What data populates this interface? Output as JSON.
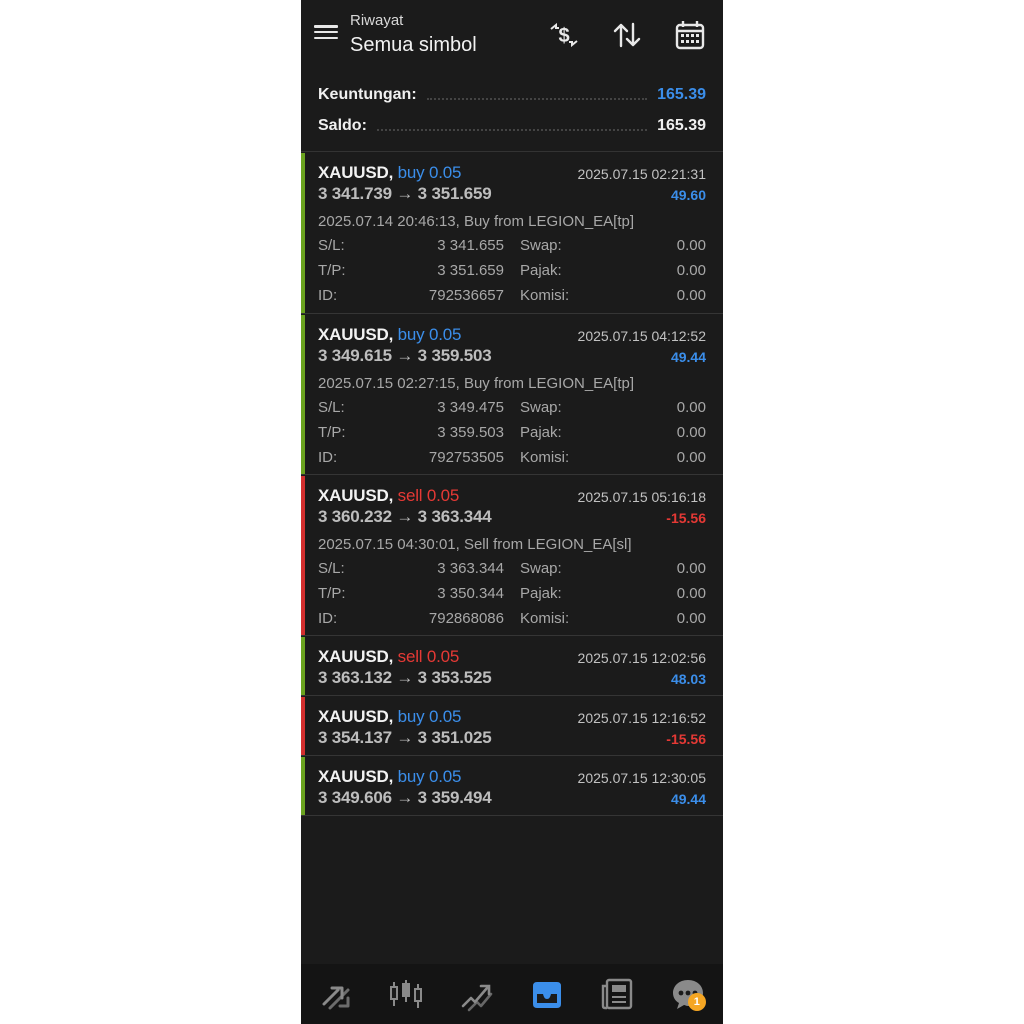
{
  "colors": {
    "blue": "#3b8eea",
    "red": "#e53935",
    "green_bar": "#6aa31f",
    "red_bar": "#d32f2f"
  },
  "header": {
    "subtitle": "Riwayat",
    "title": "Semua simbol",
    "icons": [
      "currency-exchange-icon",
      "sort-arrows-icon",
      "calendar-icon"
    ]
  },
  "summary": {
    "profit_label": "Keuntungan:",
    "profit_value": "165.39",
    "balance_label": "Saldo:",
    "balance_value": "165.39"
  },
  "deals": [
    {
      "symbol": "XAUUSD,",
      "side": "buy 0.05",
      "side_color": "blue",
      "prices": "3 341.739 → 3 351.659",
      "time": "2025.07.15 02:21:31",
      "profit": "49.60",
      "profit_color": "blue",
      "bar": "green",
      "expanded": true,
      "comment": "2025.07.14 20:46:13, Buy from LEGION_EA[tp]",
      "sl_label": "S/L:",
      "sl": "3 341.655",
      "tp_label": "T/P:",
      "tp": "3 351.659",
      "id_label": "ID:",
      "id": "792536657",
      "swap_label": "Swap:",
      "swap": "0.00",
      "tax_label": "Pajak:",
      "tax": "0.00",
      "commission_label": "Komisi:",
      "commission": "0.00"
    },
    {
      "symbol": "XAUUSD,",
      "side": "buy 0.05",
      "side_color": "blue",
      "prices": "3 349.615 → 3 359.503",
      "time": "2025.07.15 04:12:52",
      "profit": "49.44",
      "profit_color": "blue",
      "bar": "green",
      "expanded": true,
      "comment": "2025.07.15 02:27:15, Buy from LEGION_EA[tp]",
      "sl_label": "S/L:",
      "sl": "3 349.475",
      "tp_label": "T/P:",
      "tp": "3 359.503",
      "id_label": "ID:",
      "id": "792753505",
      "swap_label": "Swap:",
      "swap": "0.00",
      "tax_label": "Pajak:",
      "tax": "0.00",
      "commission_label": "Komisi:",
      "commission": "0.00"
    },
    {
      "symbol": "XAUUSD,",
      "side": "sell 0.05",
      "side_color": "red",
      "prices": "3 360.232 → 3 363.344",
      "time": "2025.07.15 05:16:18",
      "profit": "-15.56",
      "profit_color": "red",
      "bar": "red",
      "expanded": true,
      "comment": "2025.07.15 04:30:01, Sell from LEGION_EA[sl]",
      "sl_label": "S/L:",
      "sl": "3 363.344",
      "tp_label": "T/P:",
      "tp": "3 350.344",
      "id_label": "ID:",
      "id": "792868086",
      "swap_label": "Swap:",
      "swap": "0.00",
      "tax_label": "Pajak:",
      "tax": "0.00",
      "commission_label": "Komisi:",
      "commission": "0.00"
    },
    {
      "symbol": "XAUUSD,",
      "side": "sell 0.05",
      "side_color": "red",
      "prices": "3 363.132 → 3 353.525",
      "time": "2025.07.15 12:02:56",
      "profit": "48.03",
      "profit_color": "blue",
      "bar": "green",
      "expanded": false
    },
    {
      "symbol": "XAUUSD,",
      "side": "buy 0.05",
      "side_color": "blue",
      "prices": "3 354.137 → 3 351.025",
      "time": "2025.07.15 12:16:52",
      "profit": "-15.56",
      "profit_color": "red",
      "bar": "red",
      "expanded": false
    },
    {
      "symbol": "XAUUSD,",
      "side": "buy 0.05",
      "side_color": "blue",
      "prices": "3 349.606 → 3 359.494",
      "time": "2025.07.15 12:30:05",
      "profit": "49.44",
      "profit_color": "blue",
      "bar": "green",
      "expanded": false
    }
  ],
  "bottom_nav": {
    "items": [
      "quotes-icon",
      "chart-candles-icon",
      "trade-icon",
      "history-inbox-icon",
      "news-icon",
      "chat-icon"
    ],
    "active": "history-inbox-icon",
    "chat_badge": "1"
  }
}
